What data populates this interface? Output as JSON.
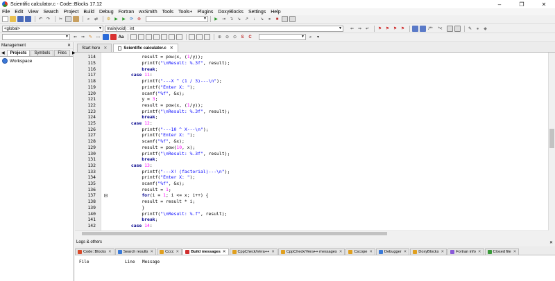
{
  "window": {
    "title": "Scientific calculator.c - Code::Blocks 17.12",
    "buttons": [
      "–",
      "❐",
      "✕"
    ]
  },
  "menu": [
    "File",
    "Edit",
    "View",
    "Search",
    "Project",
    "Build",
    "Debug",
    "Fortran",
    "wxSmith",
    "Tools",
    "Tools+",
    "Plugins",
    "DoxyBlocks",
    "Settings",
    "Help"
  ],
  "scope": {
    "global": "<global>",
    "function": "main(void) : int"
  },
  "management": {
    "title": "Management",
    "tabs": [
      "Projects",
      "Symbols",
      "Files"
    ],
    "workspace": "Workspace"
  },
  "editor": {
    "tabs": [
      {
        "label": "Start here",
        "active": false
      },
      {
        "label": "Scientific calculator.c",
        "active": true
      }
    ],
    "lines": [
      {
        "n": "114",
        "indent": 12,
        "text": "result = pow(x, (1/y));"
      },
      {
        "n": "115",
        "indent": 12,
        "text": "printf(\"\\nResult: %.3f\", result);"
      },
      {
        "n": "116",
        "indent": 12,
        "text": "break;"
      },
      {
        "n": "117",
        "indent": 8,
        "text": "case 11:"
      },
      {
        "n": "118",
        "indent": 12,
        "text": "printf(\"---X ^ (1 / 3)---\\n\");"
      },
      {
        "n": "119",
        "indent": 12,
        "text": "printf(\"Enter X: \");"
      },
      {
        "n": "120",
        "indent": 12,
        "text": "scanf(\"%f\", &x);"
      },
      {
        "n": "121",
        "indent": 12,
        "text": "y = 3;"
      },
      {
        "n": "122",
        "indent": 12,
        "text": "result = pow(x, (1/y));"
      },
      {
        "n": "123",
        "indent": 12,
        "text": "printf(\"\\nResult: %.3f\", result);"
      },
      {
        "n": "124",
        "indent": 12,
        "text": "break;"
      },
      {
        "n": "125",
        "indent": 8,
        "text": "case 12:"
      },
      {
        "n": "126",
        "indent": 12,
        "text": "printf(\"---10 ^ X---\\n\");"
      },
      {
        "n": "127",
        "indent": 12,
        "text": "printf(\"Enter X: \");"
      },
      {
        "n": "128",
        "indent": 12,
        "text": "scanf(\"%f\", &x);"
      },
      {
        "n": "129",
        "indent": 12,
        "text": "result = pow(10, x);"
      },
      {
        "n": "130",
        "indent": 12,
        "text": "printf(\"\\nResult: %.3f\", result);"
      },
      {
        "n": "131",
        "indent": 12,
        "text": "break;"
      },
      {
        "n": "132",
        "indent": 8,
        "text": "case 13:"
      },
      {
        "n": "133",
        "indent": 12,
        "text": "printf(\"---X! (factorial)---\\n\");"
      },
      {
        "n": "134",
        "indent": 12,
        "text": "printf(\"Enter X: \");"
      },
      {
        "n": "135",
        "indent": 12,
        "text": "scanf(\"%f\", &x);"
      },
      {
        "n": "136",
        "indent": 12,
        "text": "result = 1;"
      },
      {
        "n": "137",
        "indent": 12,
        "text": "for(i = 1; i <= x; i++) {"
      },
      {
        "n": "138",
        "indent": 12,
        "text": "result = result * i;"
      },
      {
        "n": "139",
        "indent": 12,
        "text": "}"
      },
      {
        "n": "140",
        "indent": 12,
        "text": "printf(\"\\nResult: %.f\", result);"
      },
      {
        "n": "141",
        "indent": 12,
        "text": "break;"
      },
      {
        "n": "142",
        "indent": 8,
        "text": "case 14:"
      }
    ]
  },
  "logs": {
    "title": "Logs & others",
    "tabs": [
      {
        "label": "Code::Blocks",
        "color": "#d84a2a",
        "active": false
      },
      {
        "label": "Search results",
        "color": "#3a7ad8",
        "active": false
      },
      {
        "label": "Cccc",
        "color": "#e0a020",
        "active": false
      },
      {
        "label": "Build messages",
        "color": "#d03030",
        "active": true
      },
      {
        "label": "CppCheck/Vera++",
        "color": "#e0a020",
        "active": false
      },
      {
        "label": "CppCheck/Vera++ messages",
        "color": "#e0a020",
        "active": false
      },
      {
        "label": "Cscope",
        "color": "#e0a020",
        "active": false
      },
      {
        "label": "Debugger",
        "color": "#3a7ad8",
        "active": false
      },
      {
        "label": "DoxyBlocks",
        "color": "#e0a020",
        "active": false
      },
      {
        "label": "Fortran info",
        "color": "#8a5ad8",
        "active": false
      },
      {
        "label": "Closed file",
        "color": "#3a9a3a",
        "active": false
      }
    ],
    "columns": [
      "File",
      "Line",
      "Message"
    ]
  }
}
